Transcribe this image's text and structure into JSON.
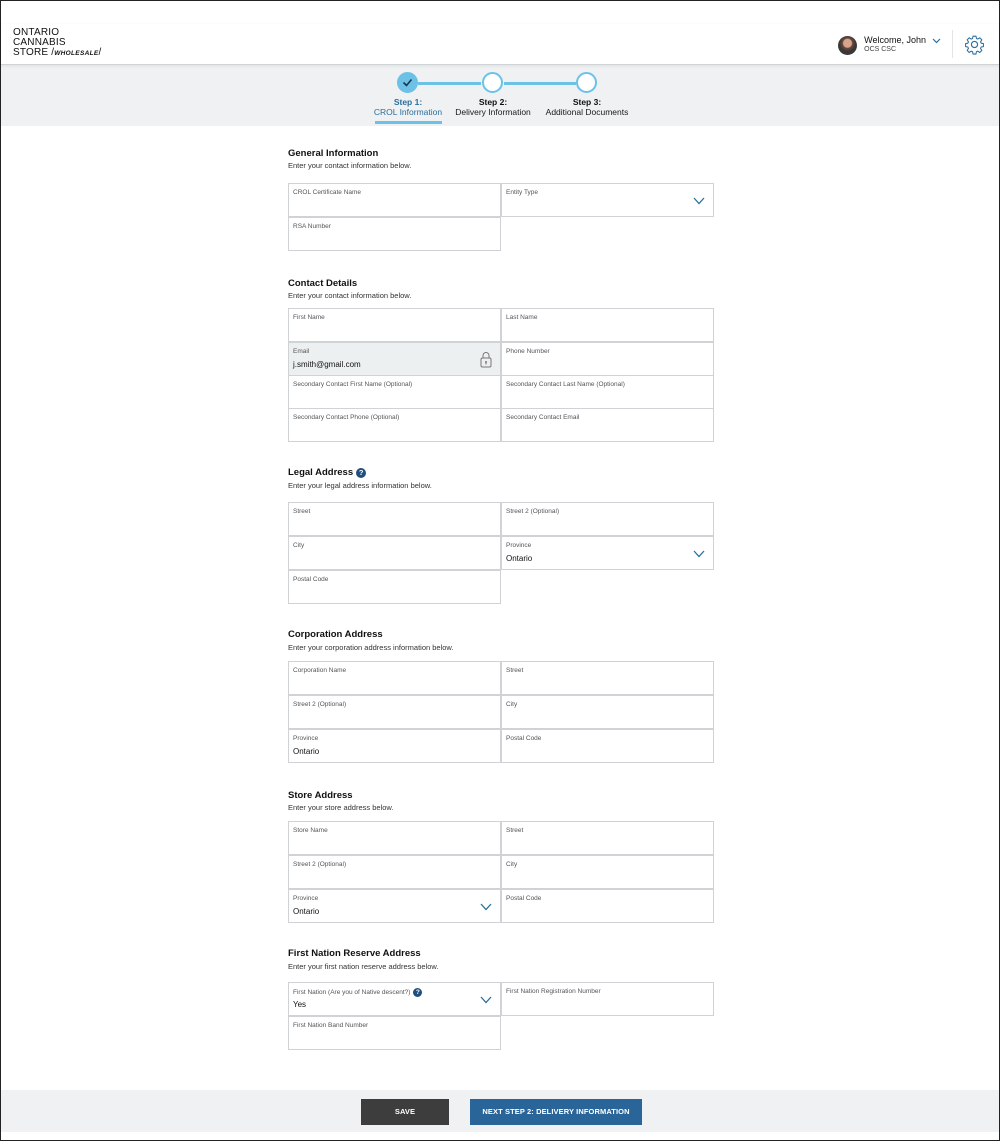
{
  "brand": {
    "line1": "ONTARIO",
    "line2": "CANNABIS",
    "line3": "STORE",
    "wholesale": "WHOLESALE"
  },
  "user": {
    "welcome": "Welcome, John",
    "org": "OCS CSC",
    "avatar_icon": "user-avatar"
  },
  "stepper": {
    "steps": [
      {
        "title": "Step 1:",
        "label": "CROL Information",
        "state": "complete"
      },
      {
        "title": "Step 2:",
        "label": "Delivery Information",
        "state": "pending"
      },
      {
        "title": "Step 3:",
        "label": "Additional Documents",
        "state": "pending"
      }
    ]
  },
  "sections": {
    "general": {
      "title": "General Information",
      "subtitle": "Enter your contact information below.",
      "fields": {
        "crol_certificate_name": {
          "label": "CROL Certificate Name",
          "value": ""
        },
        "entity_type": {
          "label": "Entity Type",
          "value": ""
        },
        "rsa_number": {
          "label": "RSA Number",
          "value": ""
        }
      }
    },
    "contact": {
      "title": "Contact Details",
      "subtitle": "Enter your contact information below.",
      "fields": {
        "first_name": {
          "label": "First Name",
          "value": ""
        },
        "last_name": {
          "label": "Last Name",
          "value": ""
        },
        "email": {
          "label": "Email",
          "value": "j.smith@gmail.com"
        },
        "phone": {
          "label": "Phone Number",
          "value": ""
        },
        "sec_first": {
          "label": "Secondary Contact First Name (Optional)",
          "value": ""
        },
        "sec_last": {
          "label": "Secondary Contact Last Name (Optional)",
          "value": ""
        },
        "sec_phone": {
          "label": "Secondary Contact Phone (Optional)",
          "value": ""
        },
        "sec_email": {
          "label": "Secondary Contact Email",
          "value": ""
        }
      }
    },
    "legal": {
      "title": "Legal Address",
      "subtitle": "Enter your legal address information below.",
      "fields": {
        "street": {
          "label": "Street",
          "value": ""
        },
        "street2": {
          "label": "Street 2 (Optional)",
          "value": ""
        },
        "city": {
          "label": "City",
          "value": ""
        },
        "province": {
          "label": "Province",
          "value": "Ontario"
        },
        "postal": {
          "label": "Postal Code",
          "value": ""
        }
      }
    },
    "corporation": {
      "title": "Corporation Address",
      "subtitle": "Enter your corporation address information below.",
      "fields": {
        "corp_name": {
          "label": "Corporation Name",
          "value": ""
        },
        "street": {
          "label": "Street",
          "value": ""
        },
        "street2": {
          "label": "Street 2 (Optional)",
          "value": ""
        },
        "city": {
          "label": "City",
          "value": ""
        },
        "province": {
          "label": "Province",
          "value": "Ontario"
        },
        "postal": {
          "label": "Postal Code",
          "value": ""
        }
      }
    },
    "store": {
      "title": "Store Address",
      "subtitle": "Enter your store address below.",
      "fields": {
        "store_name": {
          "label": "Store Name",
          "value": ""
        },
        "street": {
          "label": "Street",
          "value": ""
        },
        "street2": {
          "label": "Street 2 (Optional)",
          "value": ""
        },
        "city": {
          "label": "City",
          "value": ""
        },
        "province": {
          "label": "Province",
          "value": "Ontario"
        },
        "postal": {
          "label": "Postal Code",
          "value": ""
        }
      }
    },
    "first_nation": {
      "title": "First Nation Reserve Address",
      "subtitle": "Enter your first nation reserve address below.",
      "fields": {
        "native": {
          "label": "First Nation (Are you of Native descent?)",
          "value": "Yes"
        },
        "registration": {
          "label": "First Nation Registration Number",
          "value": ""
        },
        "band": {
          "label": "First Nation Band Number",
          "value": ""
        }
      }
    }
  },
  "footer": {
    "save_label": "SAVE",
    "next_label": "NEXT STEP 2: DELIVERY INFORMATION"
  },
  "colors": {
    "accent": "#6cc1e6",
    "primary_button": "#2a6599",
    "secondary_button": "#3d3d3d",
    "help_icon": "#1f4f7e"
  }
}
